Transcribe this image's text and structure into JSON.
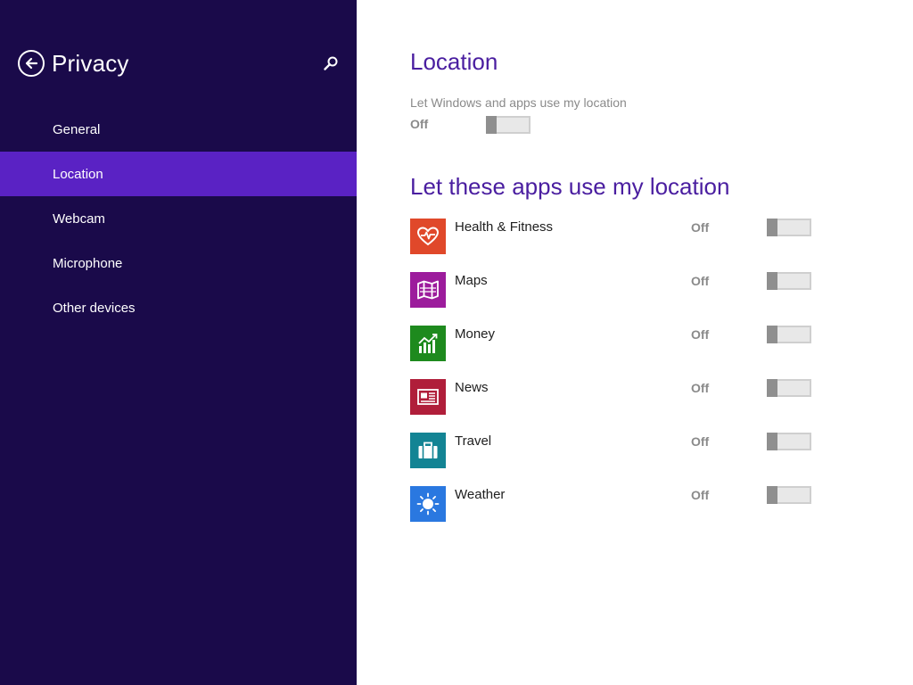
{
  "sidebar": {
    "title": "Privacy",
    "items": [
      {
        "label": "General"
      },
      {
        "label": "Location"
      },
      {
        "label": "Webcam"
      },
      {
        "label": "Microphone"
      },
      {
        "label": "Other devices"
      }
    ],
    "active_index": 1
  },
  "main": {
    "section_title": "Location",
    "location_setting": {
      "label": "Let Windows and apps use my location",
      "state": "Off"
    },
    "apps_title": "Let these apps use my location",
    "apps": [
      {
        "name": "Health & Fitness",
        "state": "Off",
        "icon": "heart-pulse-icon",
        "color": "#e0482a"
      },
      {
        "name": "Maps",
        "state": "Off",
        "icon": "map-icon",
        "color": "#9c1c9c"
      },
      {
        "name": "Money",
        "state": "Off",
        "icon": "chart-icon",
        "color": "#1e8a1e"
      },
      {
        "name": "News",
        "state": "Off",
        "icon": "newspaper-icon",
        "color": "#b01e3a"
      },
      {
        "name": "Travel",
        "state": "Off",
        "icon": "suitcase-icon",
        "color": "#138494"
      },
      {
        "name": "Weather",
        "state": "Off",
        "icon": "sun-icon",
        "color": "#2a78e0"
      }
    ]
  },
  "colors": {
    "sidebar_bg": "#1a0a4a",
    "active_item_bg": "#5a22c4",
    "heading": "#4a1ea0"
  }
}
